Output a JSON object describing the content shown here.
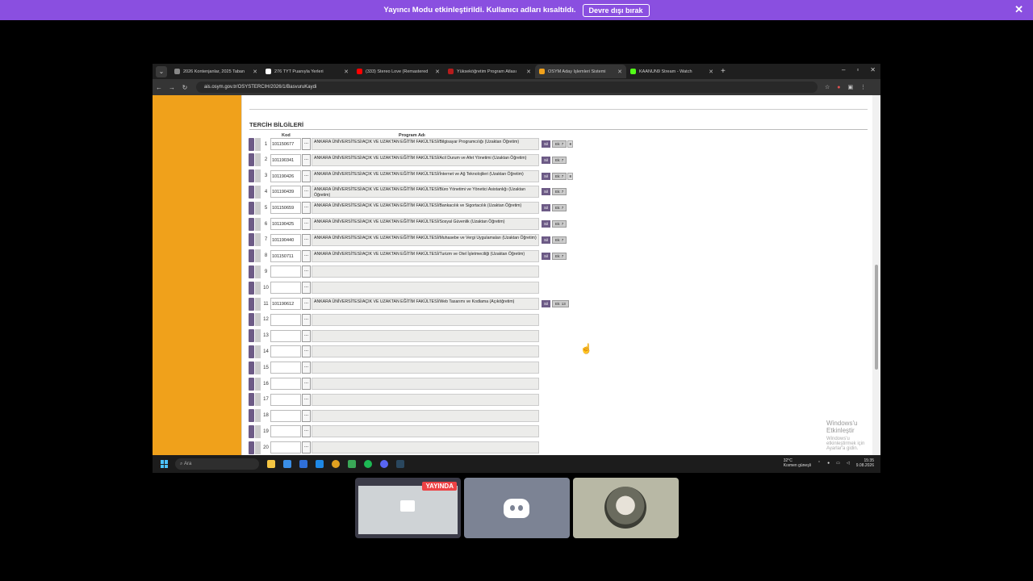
{
  "banner": {
    "text": "Yayıncı Modu etkinleştirildi. Kullanıcı adları kısaltıldı.",
    "button": "Devre dışı bırak"
  },
  "browser": {
    "tabs": [
      {
        "title": "2026 Kontenjanlar, 2025 Taban",
        "color": "#888888"
      },
      {
        "title": "276 TYT Puanıyla Yerleri",
        "color": "#ffffff"
      },
      {
        "title": "(333) Stereo Love (Remastered",
        "color": "#ff0000"
      },
      {
        "title": "Yükseköğretim Program Atlası",
        "color": "#b71c1c"
      },
      {
        "title": "ÖSYM Aday İşlemleri Sistemi",
        "color": "#f0a11b"
      },
      {
        "title": "KAANUN9 Stream - Watch",
        "color": "#53fc18"
      }
    ],
    "url": "ais.osym.gov.tr/OSYSTERCIH/2026/1/BasvuruKaydi"
  },
  "page": {
    "section_title": "TERCİH BİLGİLERİ",
    "col_kod": "Kod",
    "col_program": "Program Adı",
    "dots": "...",
    "sil": "Sil",
    "rows": [
      {
        "n": "1",
        "code": "101150677",
        "program": "ANKARA ÜNİVERSİTESİ/AÇIK VE UZAKTAN EĞİTİM FAKÜLTESİ/Bilgisayar Programcılığı (Uzaktan Öğretim)",
        "ek": "Ek: 7",
        "ek2": "8"
      },
      {
        "n": "2",
        "code": "101190341",
        "program": "ANKARA ÜNİVERSİTESİ/AÇIK VE UZAKTAN EĞİTİM FAKÜLTESİ/Acil Durum ve Afet Yönetimi (Uzaktan Öğretim)",
        "ek": "Ek: 7",
        "ek2": ""
      },
      {
        "n": "3",
        "code": "101190426",
        "program": "ANKARA ÜNİVERSİTESİ/AÇIK VE UZAKTAN EĞİTİM FAKÜLTESİ/İnternet ve Ağ Teknolojileri (Uzaktan Öğretim)",
        "ek": "Ek: 7",
        "ek2": "8"
      },
      {
        "n": "4",
        "code": "101190439",
        "program": "ANKARA ÜNİVERSİTESİ/AÇIK VE UZAKTAN EĞİTİM FAKÜLTESİ/Büro Yönetimi ve Yönetici Asistanlığı (Uzaktan Öğretim)",
        "ek": "Ek: 7",
        "ek2": ""
      },
      {
        "n": "5",
        "code": "101150659",
        "program": "ANKARA ÜNİVERSİTESİ/AÇIK VE UZAKTAN EĞİTİM FAKÜLTESİ/Bankacılık ve Sigortacılık (Uzaktan Öğretim)",
        "ek": "Ek: 7",
        "ek2": ""
      },
      {
        "n": "6",
        "code": "101190425",
        "program": "ANKARA ÜNİVERSİTESİ/AÇIK VE UZAKTAN EĞİTİM FAKÜLTESİ/Sosyal Güvenlik (Uzaktan Öğretim)",
        "ek": "Ek: 7",
        "ek2": ""
      },
      {
        "n": "7",
        "code": "101190440",
        "program": "ANKARA ÜNİVERSİTESİ/AÇIK VE UZAKTAN EĞİTİM FAKÜLTESİ/Muhasebe ve Vergi Uygulamaları (Uzaktan Öğretim)",
        "ek": "Ek: 7",
        "ek2": ""
      },
      {
        "n": "8",
        "code": "101150711",
        "program": "ANKARA ÜNİVERSİTESİ/AÇIK VE UZAKTAN EĞİTİM FAKÜLTESİ/Turizm ve Otel İşletmeciliği (Uzaktan Öğretim)",
        "ek": "Ek: 7",
        "ek2": ""
      },
      {
        "n": "9",
        "code": "",
        "program": "",
        "ek": "",
        "ek2": ""
      },
      {
        "n": "10",
        "code": "",
        "program": "",
        "ek": "",
        "ek2": ""
      },
      {
        "n": "11",
        "code": "101190612",
        "program": "ANKARA ÜNİVERSİTESİ/AÇIK VE UZAKTAN EĞİTİM FAKÜLTESİ/Web Tasarımı ve Kodlama (Açıköğretim)",
        "ek": "Ek: 13",
        "ek2": ""
      },
      {
        "n": "12",
        "code": "",
        "program": "",
        "ek": "",
        "ek2": ""
      },
      {
        "n": "13",
        "code": "",
        "program": "",
        "ek": "",
        "ek2": ""
      },
      {
        "n": "14",
        "code": "",
        "program": "",
        "ek": "",
        "ek2": ""
      },
      {
        "n": "15",
        "code": "",
        "program": "",
        "ek": "",
        "ek2": ""
      },
      {
        "n": "16",
        "code": "",
        "program": "",
        "ek": "",
        "ek2": ""
      },
      {
        "n": "17",
        "code": "",
        "program": "",
        "ek": "",
        "ek2": ""
      },
      {
        "n": "18",
        "code": "",
        "program": "",
        "ek": "",
        "ek2": ""
      },
      {
        "n": "19",
        "code": "",
        "program": "",
        "ek": "",
        "ek2": ""
      },
      {
        "n": "20",
        "code": "",
        "program": "",
        "ek": "",
        "ek2": ""
      }
    ],
    "watermark_title": "Windows'u Etkinleştir",
    "watermark_sub": "Windows'u etkinleştirmek için Ayarlar'a gidin."
  },
  "taskbar": {
    "search": "Ara",
    "weather": "32°C",
    "weather_sub": "Kısmen güneşli",
    "time": "15:35",
    "date": "9.08.2026"
  },
  "call": {
    "live_badge": "YAYINDA"
  }
}
